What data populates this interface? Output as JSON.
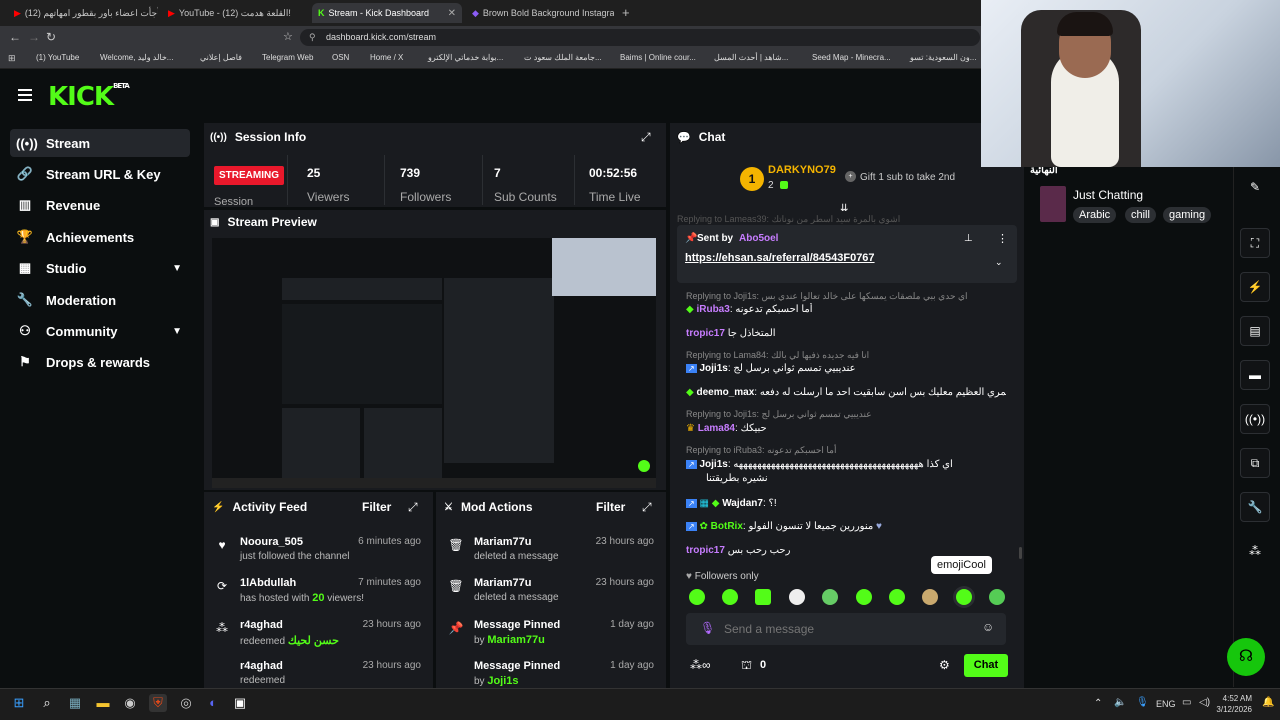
{
  "browser": {
    "tabs": [
      {
        "label": "(12) فأجأت اعضاء باور بقطور امهاتهم"
      },
      {
        "label": "YouTube - (12) القلعة هدمت!"
      },
      {
        "label": "Stream - Kick Dashboard"
      },
      {
        "label": "Brown Bold Background Instagram P"
      }
    ],
    "url": "dashboard.kick.com/stream",
    "bookmarks": [
      "(1) YouTube",
      "Welcome, خالد وليد...",
      "فاصل إعلاني",
      "Telegram Web",
      "OSN",
      "Home / X",
      "بوابة خدماتي الإلكترو...",
      "جامعة الملك سعود ت...",
      "Baims | Online cour...",
      "شاهد | أحدث المسل...",
      "Seed Map - Minecra...",
      "ون السعودية: تسو..."
    ]
  },
  "sidebar": {
    "logo": "KICK",
    "logo_beta": "BETA",
    "items": [
      {
        "label": "Stream",
        "icon": "broadcast-icon"
      },
      {
        "label": "Stream URL & Key",
        "icon": "link-icon"
      },
      {
        "label": "Revenue",
        "icon": "chart-icon"
      },
      {
        "label": "Achievements",
        "icon": "trophy-icon"
      },
      {
        "label": "Studio",
        "icon": "film-icon"
      },
      {
        "label": "Moderation",
        "icon": "wrench-icon"
      },
      {
        "label": "Community",
        "icon": "community-icon"
      },
      {
        "label": "Drops & rewards",
        "icon": "gift-icon"
      }
    ]
  },
  "session": {
    "title": "Session Info",
    "status": "STREAMING",
    "status_sub": "Session",
    "stats": [
      {
        "value": "25",
        "label": "Viewers"
      },
      {
        "value": "739",
        "label": "Followers"
      },
      {
        "value": "7",
        "label": "Sub Counts"
      },
      {
        "value": "00:52:56",
        "label": "Time Live"
      }
    ]
  },
  "preview": {
    "title": "Stream Preview"
  },
  "activity": {
    "title": "Activity Feed",
    "filter": "Filter",
    "items": [
      {
        "user": "Nooura_505",
        "text": "just followed the channel",
        "time": "6 minutes ago",
        "icon": "heart-icon"
      },
      {
        "user": "1lAbdullah",
        "text_pre": "has hosted with ",
        "count": "20",
        "text_post": " viewers!",
        "time": "7 minutes ago",
        "icon": "host-icon"
      },
      {
        "user": "r4aghad",
        "text_pre": "redeemed ",
        "reward": "حسن لحيك",
        "time": "23 hours ago",
        "icon": "points-icon"
      },
      {
        "user": "r4aghad",
        "text": "redeemed",
        "time": "23 hours ago",
        "icon": "points-icon"
      }
    ]
  },
  "mod": {
    "title": "Mod Actions",
    "filter": "Filter",
    "items": [
      {
        "user": "Mariam77u",
        "text": "deleted a message",
        "time": "23 hours ago",
        "icon": "trash-icon"
      },
      {
        "user": "Mariam77u",
        "text": "deleted a message",
        "time": "23 hours ago",
        "icon": "trash-icon"
      },
      {
        "user": "Message Pinned",
        "text_pre": "by ",
        "by": "Mariam77u",
        "time": "1 day ago",
        "icon": "pin-icon"
      },
      {
        "user": "Message Pinned",
        "text_pre": "by ",
        "by": "Joji1s",
        "time": "1 day ago",
        "icon": "pin-icon"
      }
    ]
  },
  "chat": {
    "title": "Chat",
    "top_gifter": {
      "rank": "1",
      "name": "DARKYNO79",
      "count": "2"
    },
    "gift_text": "Gift 1 sub to take 2nd",
    "pinned": {
      "label": "Sent by",
      "user": "Abo5oel",
      "link": "https://ehsan.sa/referral/84543F0767"
    },
    "faded_reply": "Replying to Lameas39: اشوي بالمرة سيد اسطر من نوناتك",
    "messages": [
      {
        "reply": "Replying to Joji1s: اي حدي ببي ملصقات يمسكها على خالد تعالوا عندي بس",
        "user": "iRuba3",
        "color": "#c77dff",
        "text": "أما احسبكم تدعونه"
      },
      {
        "user": "tropic17",
        "color": "#c77dff",
        "text": "المتخاذل جا"
      },
      {
        "reply": "Replying to Lama84: انا فيه جديده ذفيها لي بالك",
        "user": "Joji1s",
        "color": "#ffffff",
        "text": "عنديبيي تمسم ثواني برسل لج"
      },
      {
        "user": "deemo_max",
        "color": "#ffffff",
        "text": "ي استريمري العظيم معليك بس اسن سابقيت احد ما ارسلت له دفعه"
      },
      {
        "reply": "Replying to Joji1s: عنديبيي تمسم ثواني برسل لج",
        "user": "Lama84",
        "color": "#c77dff",
        "text": "حبيكك"
      },
      {
        "reply": "Replying to iRuba3: أما احسبكم تدعونه",
        "user": "Joji1s",
        "color": "#ffffff",
        "text": "اي كذا ههههههههههههههههههههههههههههههههههههههههه"
      },
      {
        "cont": "نشيره بطريقتنا"
      },
      {
        "user": "Wajdan7",
        "color": "#ffffff",
        "text": "؟!"
      },
      {
        "user": "BotRix",
        "color": "#53fc18",
        "text": "منوررين جميعا لا تنسون الفولو"
      },
      {
        "user": "tropic17",
        "color": "#c77dff",
        "text": "رحب رحب بس"
      }
    ],
    "followers_only": "Followers only",
    "tooltip": "emojiCool",
    "placeholder": "Send a message",
    "points": "0",
    "send": "Chat"
  },
  "stream_info": {
    "title_fragment": "النهائية",
    "category": "Just Chatting",
    "tags": [
      "Arabic",
      "chill",
      "gaming"
    ]
  },
  "taskbar": {
    "time": "4:52 AM",
    "date": "3/12/2026",
    "lang": "ENG"
  },
  "colors": {
    "accent": "#53fc18",
    "live": "#e9182b",
    "panel": "#191b1f",
    "bg": "#0b0e0f"
  }
}
